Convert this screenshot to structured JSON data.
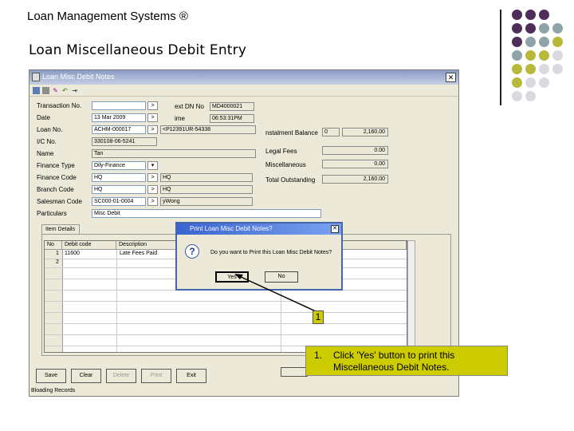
{
  "slide": {
    "title": "Loan Management Systems ®",
    "subtitle": "Loan Miscellaneous Debit Entry"
  },
  "colors": {
    "purple": "#4e2d5a",
    "teal_gray": "#8fa3a8",
    "olive": "#b8b83a",
    "light_gray": "#d9d9e0",
    "callout": "#cccc00"
  },
  "window": {
    "title": "Loan Misc Debit Notes",
    "close_glyph": "✕",
    "toolbar_icons": [
      "save-icon",
      "print-icon",
      "help-icon",
      "undo-icon",
      "exit-icon"
    ]
  },
  "form": {
    "labels": {
      "transaction_no": "Transaction No.",
      "date": "Date",
      "loan_no": "Loan No.",
      "ic_no": "I/C No.",
      "name": "Name",
      "finance_type": "Finance Type",
      "finance_code": "Finance Code",
      "branch_code": "Branch Code",
      "salesman_code": "Salesman Code",
      "particulars": "Particulars",
      "next_dn_no": "ext DN No",
      "time": "ime",
      "instalment_balance": "nstalment Balance",
      "legal_fees": "Legal Fees",
      "miscellaneous": "Miscellaneous",
      "total_outstanding": "Total Outstanding"
    },
    "values": {
      "transaction_no": "",
      "date": "13 Mar 2009",
      "loan_no": "ACHM-000017",
      "loan_vehicle": "<P12391UR-54338",
      "ic_no": "330108-06-5241",
      "name": "Tan",
      "finance_type": "Dily-Finance",
      "finance_code": "HQ",
      "finance_code_desc": "HQ",
      "branch_code": "HQ",
      "branch_code_desc": "HQ",
      "salesman_code": "SC000-01-0004",
      "salesman_name": "yWong",
      "particulars": "Misc Debit",
      "next_dn_no": "MD4000021",
      "time": "06:53:31PM",
      "instalment_balance_n": "0",
      "instalment_balance": "2,160.00",
      "legal_fees": "0.00",
      "miscellaneous": "0.00",
      "total_outstanding": "2,160.00"
    },
    "lookup_glyph": ">",
    "dropdown_glyph": "▾"
  },
  "tab_label": "Item Details",
  "table": {
    "headers": [
      "No",
      "Debit code",
      "Description"
    ],
    "rows": [
      {
        "no": "1",
        "code": "11600",
        "desc": "Late Fees Paid"
      },
      {
        "no": "2",
        "code": "",
        "desc": ""
      }
    ]
  },
  "buttons": {
    "save": "Save",
    "clear": "Clear",
    "delete": "Delete",
    "print": "Print",
    "exit": "Exit"
  },
  "status_text": "Bloading Records",
  "dialog": {
    "title": "Print Loan Misc Debit Notes?",
    "message": "Do you want to Print this Loan Misc Debit Notes?",
    "yes": "Yes",
    "no": "No",
    "close_glyph": "✕",
    "icon_glyph": "?"
  },
  "annotation": {
    "badge": "1",
    "callout_num": "1.",
    "callout_text": "Click 'Yes' button to print this Miscellaneous Debit Notes."
  }
}
